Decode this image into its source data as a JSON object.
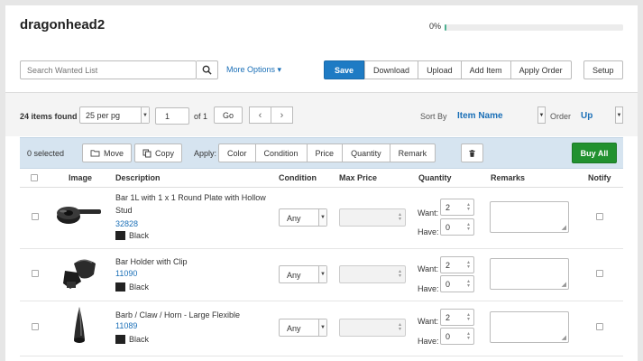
{
  "header": {
    "title": "dragonhead2",
    "progress_text": "0%",
    "progress": 0.01
  },
  "search": {
    "placeholder": "Search Wanted List"
  },
  "more_options": "More Options",
  "toolbar": {
    "save": "Save",
    "download": "Download",
    "upload": "Upload",
    "add_item": "Add Item",
    "apply_order": "Apply Order",
    "setup": "Setup"
  },
  "pagination": {
    "found": "24 items found",
    "per_page": "25 per pg",
    "page": "1",
    "of": "of 1",
    "go": "Go",
    "prev": "‹",
    "next": "›"
  },
  "sort": {
    "label": "Sort By",
    "value": "Item Name",
    "order_label": "Order",
    "order_value": "Up"
  },
  "actions": {
    "selected": "0 selected",
    "move": "Move",
    "copy": "Copy",
    "apply_label": "Apply:",
    "apply": [
      "Color",
      "Condition",
      "Price",
      "Quantity",
      "Remark"
    ],
    "buy_all": "Buy All"
  },
  "columns": {
    "image": "Image",
    "description": "Description",
    "condition": "Condition",
    "max_price": "Max Price",
    "quantity": "Quantity",
    "remarks": "Remarks",
    "notify": "Notify"
  },
  "qty_labels": {
    "want": "Want:",
    "have": "Have:"
  },
  "rows": [
    {
      "name": "Bar 1L with 1 x 1 Round Plate with Hollow Stud",
      "part": "32828",
      "color": "Black",
      "condition": "Any",
      "want": "2",
      "have": "0"
    },
    {
      "name": "Bar Holder with Clip",
      "part": "11090",
      "color": "Black",
      "condition": "Any",
      "want": "2",
      "have": "0"
    },
    {
      "name": "Barb / Claw / Horn - Large Flexible",
      "part": "11089",
      "color": "Black",
      "condition": "Any",
      "want": "2",
      "have": "0"
    }
  ],
  "colors": {
    "primary": "#1e7bc4",
    "buy": "#21912f",
    "link": "#1a6fb7",
    "part_black": "#222222"
  }
}
